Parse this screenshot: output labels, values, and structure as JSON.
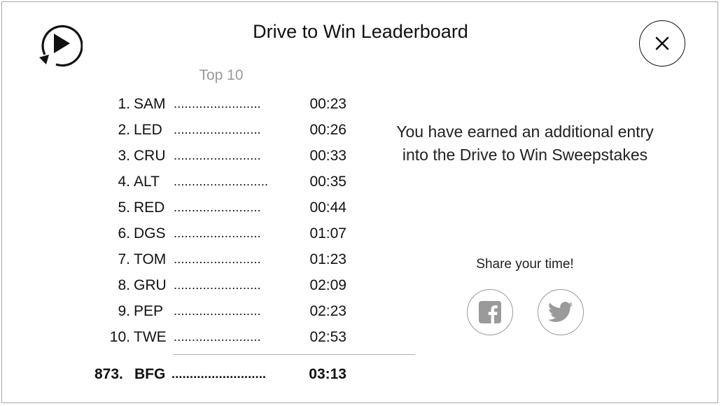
{
  "header": {
    "title": "Drive to Win Leaderboard",
    "subtitle": "Top 10",
    "replay_icon": "replay-icon",
    "close_icon": "close-icon"
  },
  "leaderboard": {
    "rows": [
      {
        "rank": "1.",
        "name": "SAM",
        "dots": "........................",
        "time": "00:23"
      },
      {
        "rank": "2.",
        "name": "LED",
        "dots": "........................",
        "time": "00:26"
      },
      {
        "rank": "3.",
        "name": "CRU",
        "dots": "........................",
        "time": "00:33"
      },
      {
        "rank": "4.",
        "name": "ALT",
        "dots": "..........................",
        "time": "00:35"
      },
      {
        "rank": "5.",
        "name": "RED",
        "dots": "........................",
        "time": "00:44"
      },
      {
        "rank": "6.",
        "name": "DGS",
        "dots": "........................",
        "time": "01:07"
      },
      {
        "rank": "7.",
        "name": "TOM",
        "dots": "........................",
        "time": "01:23"
      },
      {
        "rank": "8.",
        "name": "GRU",
        "dots": "........................",
        "time": "02:09"
      },
      {
        "rank": "9.",
        "name": "PEP",
        "dots": "........................",
        "time": "02:23"
      },
      {
        "rank": "10.",
        "name": "TWE",
        "dots": "........................",
        "time": "02:53"
      }
    ],
    "mine": {
      "rank": "873.",
      "name": "BFG",
      "dots": "..........................",
      "time": "03:13"
    }
  },
  "message": {
    "line1": "You have earned an additional entry",
    "line2": "into the Drive to Win Sweepstakes"
  },
  "share": {
    "label": "Share your time!",
    "facebook_icon": "facebook-icon",
    "twitter_icon": "twitter-icon"
  },
  "colors": {
    "text": "#111111",
    "muted": "#9a9a9a",
    "border": "#a8a8a8"
  }
}
